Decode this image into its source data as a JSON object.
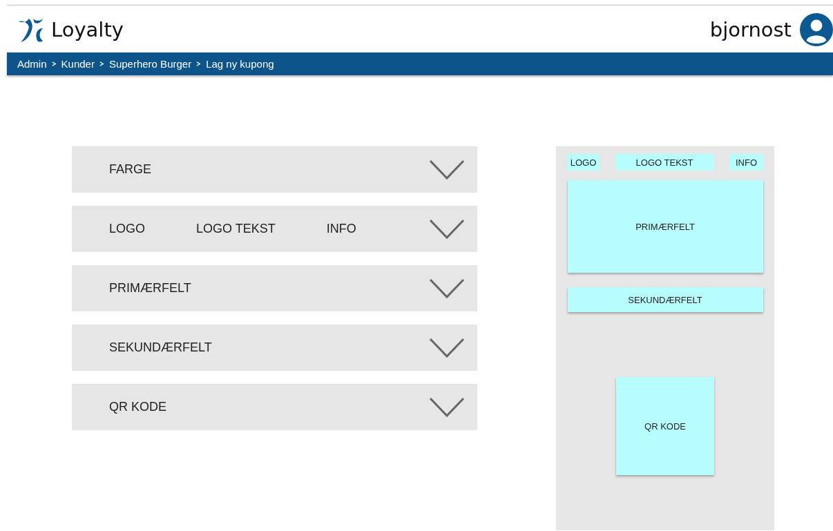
{
  "header": {
    "app_name": "Loyalty",
    "username": "bjornost"
  },
  "breadcrumb": [
    "Admin",
    "Kunder",
    "Superhero Burger",
    "Lag ny kupong"
  ],
  "sections": [
    {
      "labels": [
        "FARGE"
      ]
    },
    {
      "labels": [
        "LOGO",
        "LOGO TEKST",
        "INFO"
      ]
    },
    {
      "labels": [
        "PRIMÆRFELT"
      ]
    },
    {
      "labels": [
        "SEKUNDÆRFELT"
      ]
    },
    {
      "labels": [
        "QR KODE"
      ]
    }
  ],
  "preview": {
    "logo": "LOGO",
    "logo_text": "LOGO TEKST",
    "info": "INFO",
    "primary": "PRIMÆRFELT",
    "secondary": "SEKUNDÆRFELT",
    "qr": "QR KODE"
  }
}
